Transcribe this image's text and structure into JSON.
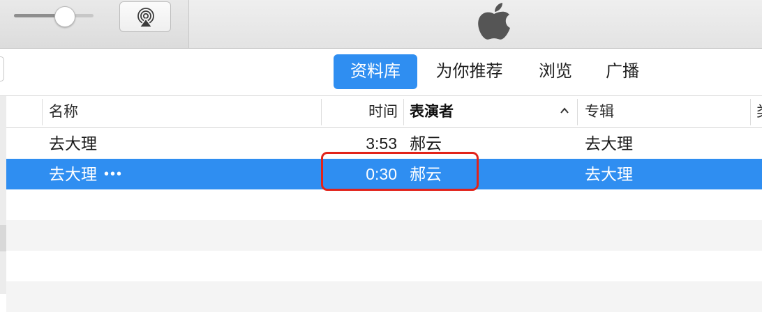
{
  "nav": {
    "tabs": [
      {
        "label": "资料库",
        "active": true
      },
      {
        "label": "为你推荐",
        "active": false
      },
      {
        "label": "浏览",
        "active": false
      },
      {
        "label": "广播",
        "active": false
      }
    ]
  },
  "player": {
    "volume_level": 0.63,
    "airplay_icon": "airplay-icon",
    "logo_icon": "apple-logo-icon"
  },
  "table": {
    "columns": {
      "name": "名称",
      "time": "时间",
      "artist": "表演者",
      "album": "专辑",
      "next": "类"
    },
    "sort_indicator": "chevron-up-icon",
    "rows": [
      {
        "name": "去大理",
        "ellipsis": "",
        "time": "3:53",
        "artist": "郝云",
        "album": "去大理"
      },
      {
        "name": "去大理",
        "ellipsis": "•••",
        "time": "0:30",
        "artist": "郝云",
        "album": "去大理"
      }
    ]
  },
  "colors": {
    "accent": "#2f8ef1",
    "highlight_border": "#e2231a",
    "alt_row": "#f4f4f4"
  }
}
